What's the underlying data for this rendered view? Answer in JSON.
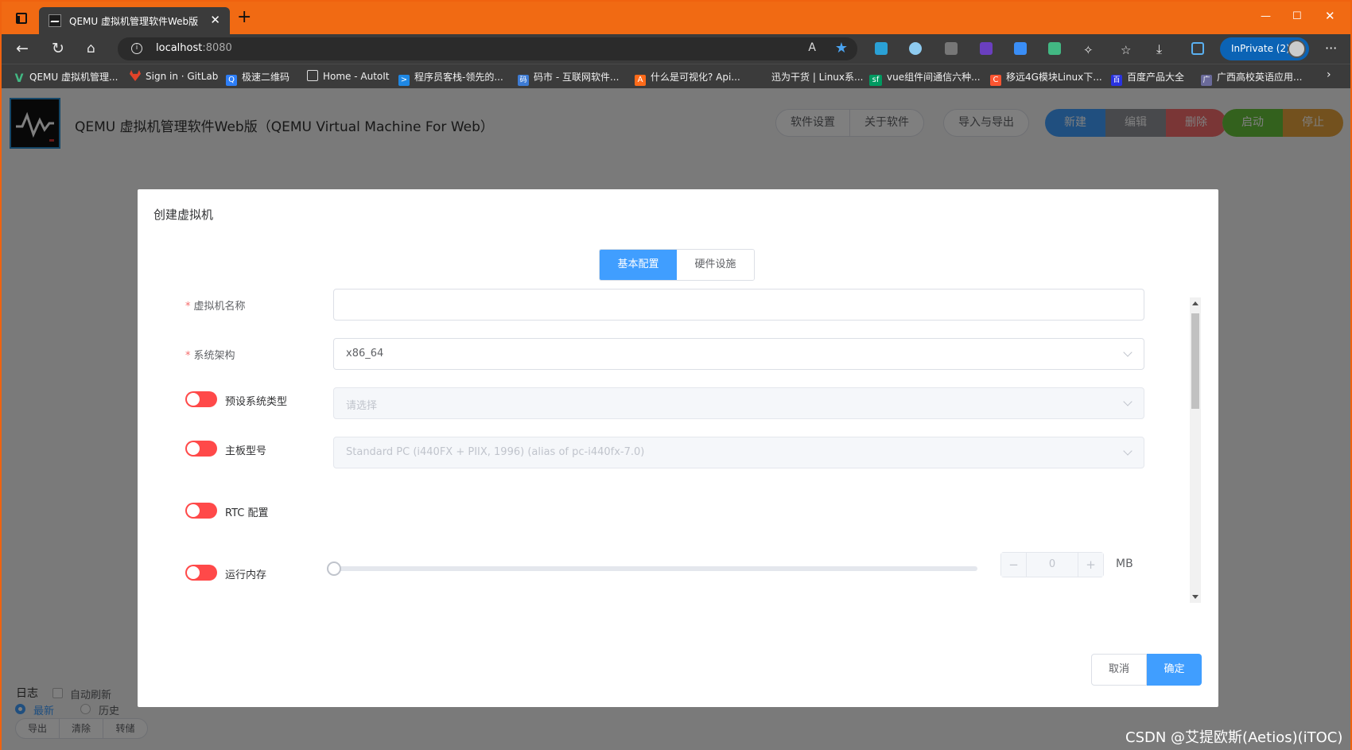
{
  "browser": {
    "tab_title": "QEMU 虚拟机管理软件Web版（(",
    "tab_close": "✕",
    "new_tab": "+",
    "url_host": "localhost",
    "url_port": ":8080",
    "read_aloud": "A",
    "inprivate": "InPrivate (2)",
    "accent": "#f16a13"
  },
  "bookmarks": [
    {
      "label": "QEMU 虚拟机管理...",
      "icon": "V",
      "color": "#42b883"
    },
    {
      "label": "Sign in · GitLab",
      "icon": "gitlab",
      "color": "#e24329"
    },
    {
      "label": "极速二维码",
      "icon": "Q",
      "color": "#2d7ef7"
    },
    {
      "label": "Home - AutoIt",
      "icon": "doc",
      "color": "#3b3b3b"
    },
    {
      "label": "程序员客栈-领先的...",
      "icon": ">",
      "color": "#1e88e5"
    },
    {
      "label": "码市 - 互联网软件...",
      "icon": "码",
      "color": "#3d7bd4"
    },
    {
      "label": "什么是可视化? Api...",
      "icon": "A",
      "color": "#ff6b1a"
    },
    {
      "label": "迅为干货 | Linux系...",
      "icon": "",
      "color": "#3b3b3b"
    },
    {
      "label": "vue组件间通信六种...",
      "icon": "sf",
      "color": "#009a61"
    },
    {
      "label": "移远4G模块Linux下...",
      "icon": "C",
      "color": "#fc5531"
    },
    {
      "label": "百度产品大全",
      "icon": "百",
      "color": "#2932e1"
    },
    {
      "label": "广西高校英语应用...",
      "icon": "广",
      "color": "#6a6a9a"
    }
  ],
  "app": {
    "title": "QEMU 虚拟机管理软件Web版（QEMU Virtual Machine For Web）",
    "btn_settings": "软件设置",
    "btn_about": "关于软件",
    "btn_import_export": "导入与导出",
    "btn_new": "新建",
    "btn_edit": "编辑",
    "btn_delete": "删除",
    "btn_start": "启动",
    "btn_stop": "停止",
    "colors": {
      "new": "#409eff",
      "edit": "#909399",
      "delete": "#f56c6c",
      "start": "#67c23a",
      "stop": "#e6a23c"
    }
  },
  "log": {
    "title": "日志",
    "auto_refresh": "自动刷新",
    "latest": "最新",
    "history": "历史",
    "export": "导出",
    "clear": "清除",
    "dump": "转储"
  },
  "dialog": {
    "title": "创建虚拟机",
    "tab_basic": "基本配置",
    "tab_hardware": "硬件设施",
    "required_mark": "*",
    "vm_name_label": "虚拟机名称",
    "vm_name_value": "",
    "arch_label": "系统架构",
    "arch_value": "x86_64",
    "preset_os_label": "预设系统类型",
    "preset_os_placeholder": "请选择",
    "board_label": "主板型号",
    "board_value": "Standard PC (i440FX + PIIX, 1996) (alias of pc-i440fx-7.0)",
    "rtc_label": "RTC 配置",
    "memory_label": "运行内存",
    "memory_value": "0",
    "memory_unit": "MB",
    "minus": "−",
    "plus": "+",
    "cancel": "取消",
    "confirm": "确定"
  },
  "watermark": "CSDN @艾提欧斯(Aetios)(iTOC)"
}
